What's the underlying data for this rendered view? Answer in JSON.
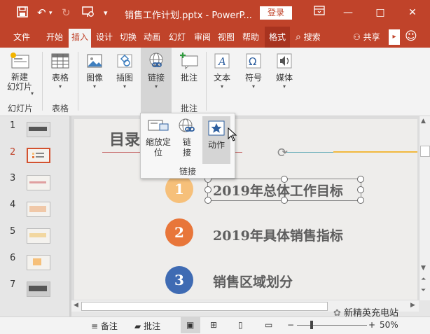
{
  "window": {
    "title": "销售工作计划.pptx - PowerP...",
    "login_label": "登录",
    "minimize_glyph": "—",
    "restore_glyph": "□",
    "close_glyph": "✕"
  },
  "quick_access": {
    "save_icon": "save-icon",
    "undo_icon": "undo-icon",
    "redo_icon": "redo-icon",
    "present_icon": "present-icon",
    "more_icon": "chevron-down-icon"
  },
  "tabs": [
    {
      "label": "文件"
    },
    {
      "label": "开始"
    },
    {
      "label": "插入",
      "active": true
    },
    {
      "label": "设计"
    },
    {
      "label": "切换"
    },
    {
      "label": "动画"
    },
    {
      "label": "幻灯"
    },
    {
      "label": "审阅"
    },
    {
      "label": "视图"
    },
    {
      "label": "帮助"
    },
    {
      "label": "格式"
    }
  ],
  "search_label": "搜索",
  "share_label": "共享",
  "ribbon": {
    "new_slide_label_line1": "新建",
    "new_slide_label_line2": "幻灯片",
    "group_slides": "幻灯片",
    "table_label": "表格",
    "group_tables": "表格",
    "image_label": "图像",
    "illustrations_label": "插图",
    "link_label": "链接",
    "comment_label": "批注",
    "group_comments": "批注",
    "text_label": "文本",
    "symbols_label": "符号",
    "media_label": "媒体"
  },
  "link_dropdown": {
    "zoom_label_line1": "缩放定",
    "zoom_label_line2": "位",
    "link_label_line1": "链",
    "link_label_line2": "接",
    "action_label": "动作",
    "group_label": "链接"
  },
  "thumbnails": [
    {
      "number": "1"
    },
    {
      "number": "2",
      "selected": true
    },
    {
      "number": "3"
    },
    {
      "number": "4"
    },
    {
      "number": "5"
    },
    {
      "number": "6"
    },
    {
      "number": "7"
    }
  ],
  "slide": {
    "title": "目录",
    "items": [
      {
        "number": "1",
        "text": "2019年总体工作目标",
        "color": "#f6c07a"
      },
      {
        "number": "2",
        "text": "2019年具体销售指标",
        "color": "#e8763a"
      },
      {
        "number": "3",
        "text": "销售区域划分",
        "color": "#3f6bb3"
      }
    ]
  },
  "status": {
    "notes_label": "备注",
    "comments_label": "批注",
    "zoom_percent": "50%",
    "watermark": "新精英充电站"
  },
  "colors": {
    "accent": "#c0432a",
    "format_tab": "#a8331f"
  }
}
